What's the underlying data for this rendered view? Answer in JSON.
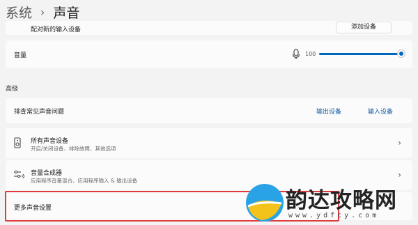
{
  "header": {
    "root": "系统",
    "separator": "›",
    "current": "声音"
  },
  "pair_row": {
    "label": "配对新的输入设备",
    "button": "添加设备"
  },
  "volume": {
    "label": "音量",
    "value_text": "100",
    "level": 1.0
  },
  "advanced": {
    "section_label": "高级"
  },
  "troubleshoot": {
    "label": "排查常见声音问题",
    "output_link": "输出设备",
    "input_link": "输入设备"
  },
  "all_devices": {
    "title": "所有声音设备",
    "subtitle": "开启/关闭设备、排除故障、其他选项"
  },
  "mixer": {
    "title": "音量合成器",
    "subtitle": "应用程序音量混合、应用程序输入 & 输出设备"
  },
  "more_settings": {
    "label": "更多声音设置"
  },
  "watermark": {
    "brand": "韵达攻略网",
    "url": "www.ydfcy.com"
  }
}
